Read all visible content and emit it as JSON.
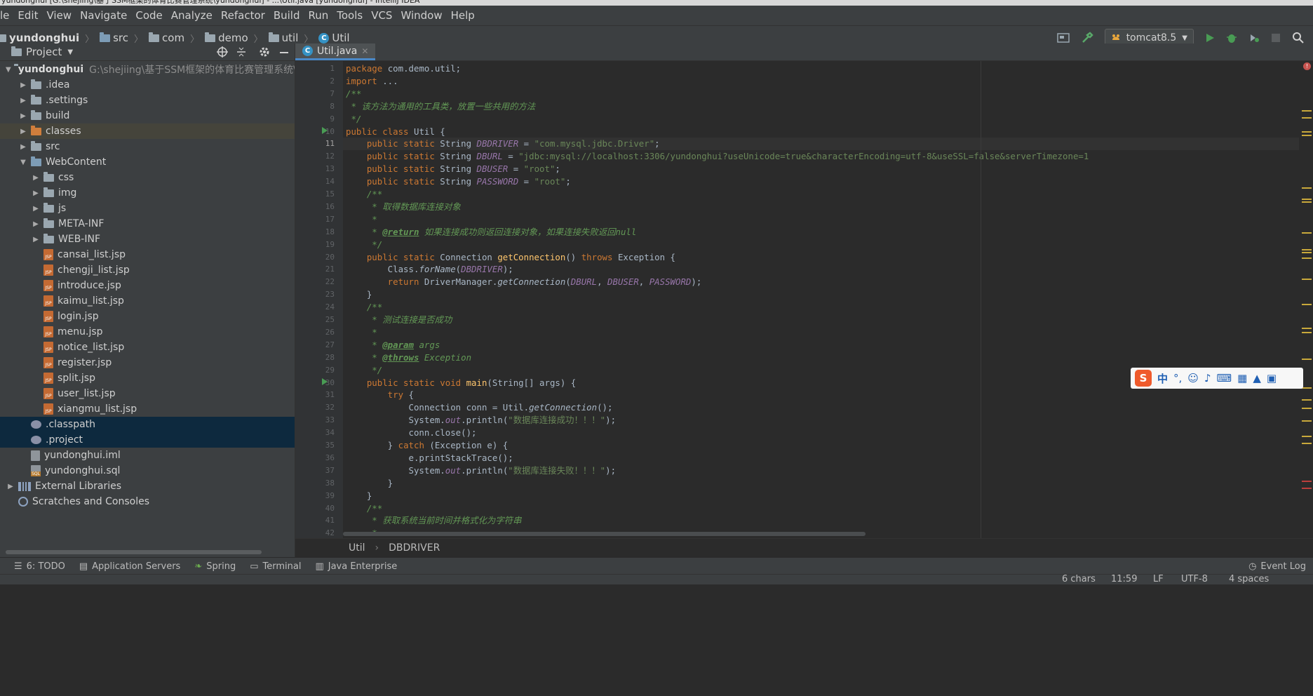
{
  "titlebar": {
    "text": "yundonghui [G:\\shejiing\\基于SSM框架的体育比赛管理系统\\yundonghui] - ...\\Util.java [yundonghui] - IntelliJ IDEA"
  },
  "menu": [
    "le",
    "Edit",
    "View",
    "Navigate",
    "Code",
    "Analyze",
    "Refactor",
    "Build",
    "Run",
    "Tools",
    "VCS",
    "Window",
    "Help"
  ],
  "nav": {
    "project": "yundonghui",
    "crumbs": [
      "src",
      "com",
      "demo",
      "util",
      "Util"
    ],
    "run_config": "tomcat8.5"
  },
  "project_panel": {
    "title": "Project",
    "root_name": "yundonghui",
    "root_path": "G:\\shejiing\\基于SSM框架的体育比赛管理系统\\yunc",
    "items": [
      {
        "label": ".idea",
        "depth": 1,
        "kind": "folder"
      },
      {
        "label": ".settings",
        "depth": 1,
        "kind": "folder"
      },
      {
        "label": "build",
        "depth": 1,
        "kind": "folder"
      },
      {
        "label": "classes",
        "depth": 1,
        "kind": "folder-orange"
      },
      {
        "label": "src",
        "depth": 1,
        "kind": "folder"
      },
      {
        "label": "WebContent",
        "depth": 1,
        "kind": "folder-web"
      },
      {
        "label": "css",
        "depth": 2,
        "kind": "folder"
      },
      {
        "label": "img",
        "depth": 2,
        "kind": "folder"
      },
      {
        "label": "js",
        "depth": 2,
        "kind": "folder"
      },
      {
        "label": "META-INF",
        "depth": 2,
        "kind": "folder"
      },
      {
        "label": "WEB-INF",
        "depth": 2,
        "kind": "folder"
      },
      {
        "label": "cansai_list.jsp",
        "depth": 2,
        "kind": "jsp"
      },
      {
        "label": "chengji_list.jsp",
        "depth": 2,
        "kind": "jsp"
      },
      {
        "label": "introduce.jsp",
        "depth": 2,
        "kind": "jsp"
      },
      {
        "label": "kaimu_list.jsp",
        "depth": 2,
        "kind": "jsp"
      },
      {
        "label": "login.jsp",
        "depth": 2,
        "kind": "jsp"
      },
      {
        "label": "menu.jsp",
        "depth": 2,
        "kind": "jsp"
      },
      {
        "label": "notice_list.jsp",
        "depth": 2,
        "kind": "jsp"
      },
      {
        "label": "register.jsp",
        "depth": 2,
        "kind": "jsp"
      },
      {
        "label": "split.jsp",
        "depth": 2,
        "kind": "jsp"
      },
      {
        "label": "user_list.jsp",
        "depth": 2,
        "kind": "jsp"
      },
      {
        "label": "xiangmu_list.jsp",
        "depth": 2,
        "kind": "jsp"
      },
      {
        "label": ".classpath",
        "depth": 1,
        "kind": "xml"
      },
      {
        "label": ".project",
        "depth": 1,
        "kind": "xml"
      },
      {
        "label": "yundonghui.iml",
        "depth": 1,
        "kind": "iml"
      },
      {
        "label": "yundonghui.sql",
        "depth": 1,
        "kind": "sql"
      },
      {
        "label": "External Libraries",
        "depth": 0,
        "kind": "lib"
      },
      {
        "label": "Scratches and Consoles",
        "depth": 0,
        "kind": "scratch"
      }
    ]
  },
  "editor": {
    "tab_label": "Util.java",
    "current_line": 11,
    "lines": [
      {
        "n": "1",
        "h": [
          [
            "kw",
            "package "
          ],
          [
            "",
            "com.demo.util;"
          ]
        ]
      },
      {
        "n": "2",
        "h": [
          [
            "kw",
            "import "
          ],
          [
            "",
            "..."
          ]
        ]
      },
      {
        "n": "7",
        "h": [
          [
            "cm",
            "/**"
          ]
        ]
      },
      {
        "n": "8",
        "h": [
          [
            "cm",
            " * 该方法为通用的工具类，放置一些共用的方法"
          ]
        ]
      },
      {
        "n": "9",
        "h": [
          [
            "cm",
            " */"
          ]
        ]
      },
      {
        "n": "10",
        "h": [
          [
            "kw",
            "public class "
          ],
          [
            "",
            "Util {"
          ]
        ]
      },
      {
        "n": "11",
        "h": [
          [
            "kw",
            "    public static "
          ],
          [
            "",
            "String "
          ],
          [
            "fld",
            "DBDRIVER"
          ],
          [
            "",
            " = "
          ],
          [
            "str",
            "\"com.mysql.jdbc.Driver\""
          ],
          [
            "",
            ";"
          ]
        ]
      },
      {
        "n": "12",
        "h": [
          [
            "kw",
            "    public static "
          ],
          [
            "",
            "String "
          ],
          [
            "fld",
            "DBURL"
          ],
          [
            "",
            " = "
          ],
          [
            "str",
            "\"jdbc:mysql://localhost:3306/yundonghui?useUnicode=true&characterEncoding=utf-8&useSSL=false&serverTimezone=1"
          ]
        ]
      },
      {
        "n": "13",
        "h": [
          [
            "kw",
            "    public static "
          ],
          [
            "",
            "String "
          ],
          [
            "fld",
            "DBUSER"
          ],
          [
            "",
            " = "
          ],
          [
            "str",
            "\"root\""
          ],
          [
            "",
            ";"
          ]
        ]
      },
      {
        "n": "14",
        "h": [
          [
            "kw",
            "    public static "
          ],
          [
            "",
            "String "
          ],
          [
            "fld",
            "PASSWORD"
          ],
          [
            "",
            " = "
          ],
          [
            "str",
            "\"root\""
          ],
          [
            "",
            ";"
          ]
        ]
      },
      {
        "n": "15",
        "h": [
          [
            "cm",
            "    /**"
          ]
        ]
      },
      {
        "n": "16",
        "h": [
          [
            "cm",
            "     * 取得数据库连接对象"
          ]
        ]
      },
      {
        "n": "17",
        "h": [
          [
            "cm",
            "     *"
          ]
        ]
      },
      {
        "n": "18",
        "h": [
          [
            "cm",
            "     * "
          ],
          [
            "tg",
            "@return"
          ],
          [
            "cm",
            " 如果连接成功则返回连接对象，如果连接失败返回null"
          ]
        ]
      },
      {
        "n": "19",
        "h": [
          [
            "cm",
            "     */"
          ]
        ]
      },
      {
        "n": "20",
        "h": [
          [
            "kw",
            "    public static "
          ],
          [
            "",
            "Connection "
          ],
          [
            "fn",
            "getConnection"
          ],
          [
            "",
            "() "
          ],
          [
            "kw",
            "throws "
          ],
          [
            "",
            "Exception {"
          ]
        ]
      },
      {
        "n": "21",
        "h": [
          [
            "",
            "        Class."
          ],
          [
            "st",
            "forName"
          ],
          [
            "",
            "("
          ],
          [
            "fld",
            "DBDRIVER"
          ],
          [
            "",
            ");"
          ]
        ]
      },
      {
        "n": "22",
        "h": [
          [
            "kw",
            "        return "
          ],
          [
            "",
            "DriverManager."
          ],
          [
            "st",
            "getConnection"
          ],
          [
            "",
            "("
          ],
          [
            "fld",
            "DBURL"
          ],
          [
            "",
            ", "
          ],
          [
            "fld",
            "DBUSER"
          ],
          [
            "",
            ", "
          ],
          [
            "fld",
            "PASSWORD"
          ],
          [
            "",
            ");"
          ]
        ]
      },
      {
        "n": "23",
        "h": [
          [
            "",
            "    }"
          ]
        ]
      },
      {
        "n": "24",
        "h": [
          [
            "cm",
            "    /**"
          ]
        ]
      },
      {
        "n": "25",
        "h": [
          [
            "cm",
            "     * 测试连接是否成功"
          ]
        ]
      },
      {
        "n": "26",
        "h": [
          [
            "cm",
            "     *"
          ]
        ]
      },
      {
        "n": "27",
        "h": [
          [
            "cm",
            "     * "
          ],
          [
            "tg",
            "@param"
          ],
          [
            "cm",
            " args"
          ]
        ]
      },
      {
        "n": "28",
        "h": [
          [
            "cm",
            "     * "
          ],
          [
            "tg",
            "@throws"
          ],
          [
            "cm",
            " Exception"
          ]
        ]
      },
      {
        "n": "29",
        "h": [
          [
            "cm",
            "     */"
          ]
        ]
      },
      {
        "n": "30",
        "h": [
          [
            "kw",
            "    public static void "
          ],
          [
            "fn",
            "main"
          ],
          [
            "",
            "(String[] args) {"
          ]
        ]
      },
      {
        "n": "31",
        "h": [
          [
            "kw",
            "        try "
          ],
          [
            "",
            "{"
          ]
        ]
      },
      {
        "n": "32",
        "h": [
          [
            "",
            "            Connection conn = Util."
          ],
          [
            "st",
            "getConnection"
          ],
          [
            "",
            "();"
          ]
        ]
      },
      {
        "n": "33",
        "h": [
          [
            "",
            "            System."
          ],
          [
            "fld",
            "out"
          ],
          [
            "",
            ".println("
          ],
          [
            "str",
            "\"数据库连接成功！！！\""
          ],
          [
            "",
            ");"
          ]
        ]
      },
      {
        "n": "34",
        "h": [
          [
            "",
            "            conn.close();"
          ]
        ]
      },
      {
        "n": "35",
        "h": [
          [
            "",
            "        } "
          ],
          [
            "kw",
            "catch "
          ],
          [
            "",
            "(Exception e) {"
          ]
        ]
      },
      {
        "n": "36",
        "h": [
          [
            "",
            "            e.printStackTrace();"
          ]
        ]
      },
      {
        "n": "37",
        "h": [
          [
            "",
            "            System."
          ],
          [
            "fld",
            "out"
          ],
          [
            "",
            ".println("
          ],
          [
            "str",
            "\"数据库连接失败！！！\""
          ],
          [
            "",
            ");"
          ]
        ]
      },
      {
        "n": "38",
        "h": [
          [
            "",
            "        }"
          ]
        ]
      },
      {
        "n": "39",
        "h": [
          [
            "",
            "    }"
          ]
        ]
      },
      {
        "n": "40",
        "h": [
          [
            "cm",
            "    /**"
          ]
        ]
      },
      {
        "n": "41",
        "h": [
          [
            "cm",
            "     * 获取系统当前时间并格式化为字符串"
          ]
        ]
      },
      {
        "n": "42",
        "h": [
          [
            "cm",
            "     *"
          ]
        ]
      }
    ]
  },
  "structure_breadcrumb": [
    "Util",
    "DBDRIVER"
  ],
  "ime": {
    "label": "中",
    "punct": "°,"
  },
  "bottom_tools": [
    {
      "label": "6: TODO"
    },
    {
      "label": "Application Servers"
    },
    {
      "label": "Spring"
    },
    {
      "label": "Terminal"
    },
    {
      "label": "Java Enterprise"
    }
  ],
  "event_log": "Event Log",
  "status": {
    "selection": "6 chars",
    "position": "11:59",
    "line_sep": "LF",
    "encoding": "UTF-8",
    "indent": "4 spaces"
  }
}
